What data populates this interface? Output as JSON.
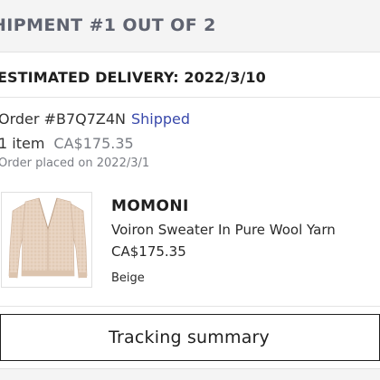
{
  "shipment": {
    "title": "HIPMENT #1 OUT OF 2"
  },
  "delivery": {
    "text": "ESTIMATED DELIVERY: 2022/3/10"
  },
  "order": {
    "number_text": "Order #B7Q7Z4N",
    "status": "Shipped",
    "status_color": "#3949ab",
    "item_count": "1 item",
    "total": "CA$175.35",
    "placed_text": "Order placed on 2022/3/1"
  },
  "product": {
    "brand": "MOMONI",
    "name": "Voiron Sweater In Pure Wool Yarn",
    "price": "CA$175.35",
    "color": "Beige",
    "image_icon": "beige-sweater-image"
  },
  "actions": {
    "tracking_label": "Tracking summary"
  }
}
